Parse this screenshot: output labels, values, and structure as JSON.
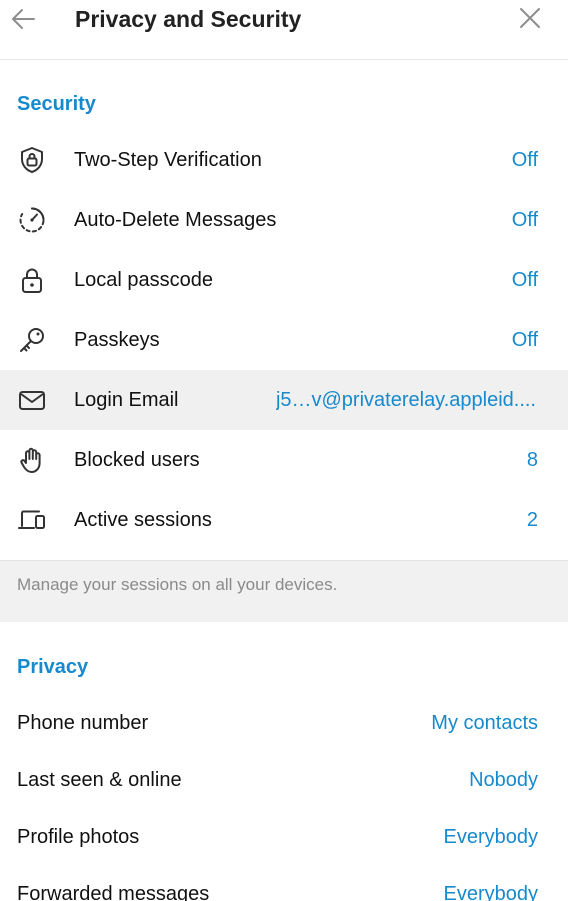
{
  "header": {
    "title": "Privacy and Security",
    "back_icon": "arrow-left-icon",
    "close_icon": "close-icon"
  },
  "security": {
    "section_title": "Security",
    "items": [
      {
        "label": "Two-Step Verification",
        "value": "Off",
        "icon": "shield-lock-icon"
      },
      {
        "label": "Auto-Delete Messages",
        "value": "Off",
        "icon": "timer-icon"
      },
      {
        "label": "Local passcode",
        "value": "Off",
        "icon": "lock-icon"
      },
      {
        "label": "Passkeys",
        "value": "Off",
        "icon": "key-icon"
      },
      {
        "label": "Login Email",
        "value": "j5…v@privaterelay.appleid....",
        "icon": "envelope-icon"
      },
      {
        "label": "Blocked users",
        "value": "8",
        "icon": "hand-icon"
      },
      {
        "label": "Active sessions",
        "value": "2",
        "icon": "devices-icon"
      }
    ],
    "note": "Manage your sessions on all your devices."
  },
  "privacy": {
    "section_title": "Privacy",
    "items": [
      {
        "label": "Phone number",
        "value": "My contacts"
      },
      {
        "label": "Last seen & online",
        "value": "Nobody"
      },
      {
        "label": "Profile photos",
        "value": "Everybody"
      },
      {
        "label": "Forwarded messages",
        "value": "Everybody"
      }
    ]
  },
  "colors": {
    "accent": "#168acd",
    "icon": "#333333",
    "note_bg": "#f1f1f1",
    "highlight_bg": "#f0f0f0"
  }
}
